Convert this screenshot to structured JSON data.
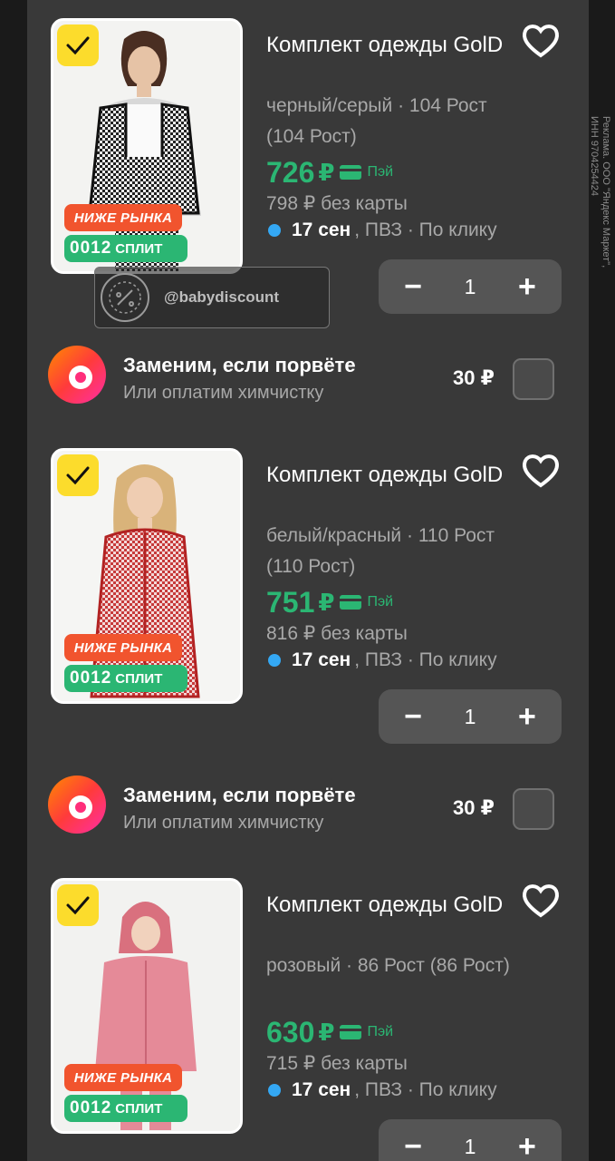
{
  "ad_disclaimer": "Реклама. ООО \"Яндекс Маркет\", ИНН 9704254424",
  "watermark": "@babydiscount",
  "colors": {
    "accent_green": "#2bb673",
    "badge_red": "#f1542e",
    "check_yellow": "#fcdc2c",
    "delivery_dot": "#34a8f4"
  },
  "products": [
    {
      "title": "Комплект одежды GolD",
      "variant": "черный/серый · 104 Рост (104 Рост)",
      "price": "726",
      "currency": "₽",
      "pay_label": "Пэй",
      "price_no_card": "798 ₽ без карты",
      "delivery_date": "17 сен",
      "delivery_rest": ", ПВЗ · По клику",
      "badge_low": "НИЖЕ РЫНКА",
      "split_amount": "0012",
      "split_label": "СПЛИТ",
      "quantity": "1",
      "minus": "−",
      "plus": "+",
      "selected": true,
      "favorite_icon": "heart-icon"
    },
    {
      "title": "Комплект одежды GolD",
      "variant": "белый/красный · 110 Рост (110 Рост)",
      "price": "751",
      "currency": "₽",
      "pay_label": "Пэй",
      "price_no_card": "816 ₽ без карты",
      "delivery_date": "17 сен",
      "delivery_rest": ", ПВЗ · По клику",
      "badge_low": "НИЖЕ РЫНКА",
      "split_amount": "0012",
      "split_label": "СПЛИТ",
      "quantity": "1",
      "minus": "−",
      "plus": "+",
      "selected": true,
      "favorite_icon": "heart-icon"
    },
    {
      "title": "Комплект одежды GolD",
      "variant": "розовый · 86 Рост (86 Рост)",
      "price": "630",
      "currency": "₽",
      "pay_label": "Пэй",
      "price_no_card": "715 ₽ без карты",
      "delivery_date": "17 сен",
      "delivery_rest": ", ПВЗ · По клику",
      "badge_low": "НИЖЕ РЫНКА",
      "split_amount": "0012",
      "split_label": "СПЛИТ",
      "quantity": "1",
      "minus": "−",
      "plus": "+",
      "selected": true,
      "favorite_icon": "heart-icon"
    }
  ],
  "insurance": [
    {
      "title": "Заменим, если порвёте",
      "subtitle": "Или оплатим химчистку",
      "price": "30 ₽",
      "checked": false
    },
    {
      "title": "Заменим, если порвёте",
      "subtitle": "Или оплатим химчистку",
      "price": "30 ₽",
      "checked": false
    }
  ]
}
